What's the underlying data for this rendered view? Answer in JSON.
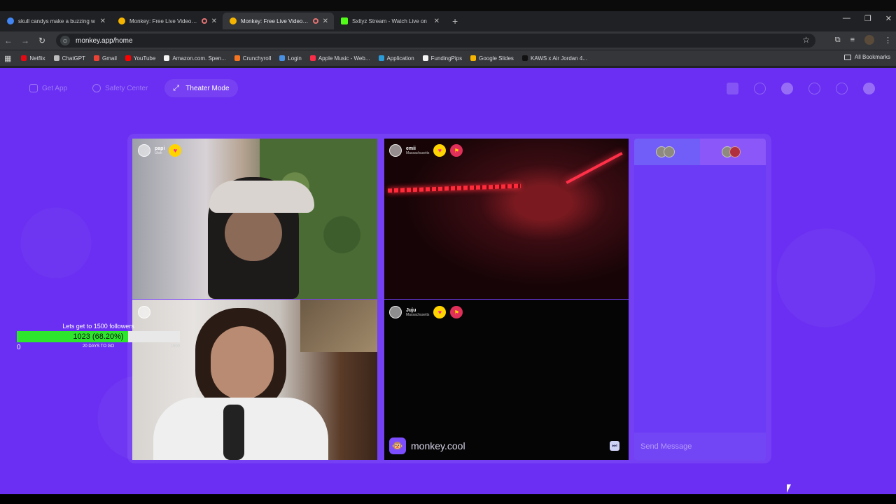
{
  "browser": {
    "tabs": [
      {
        "title": "skull candys make a buzzing w",
        "favicon_color": "#4285f4",
        "recording": false,
        "active": false
      },
      {
        "title": "Monkey: Free Live Video Ch",
        "favicon_color": "#f4b400",
        "recording": true,
        "active": false
      },
      {
        "title": "Monkey: Free Live Video Ch",
        "favicon_color": "#f4b400",
        "recording": true,
        "active": true
      },
      {
        "title": "Sxltyz Stream - Watch Live on",
        "favicon_color": "#53fc18",
        "recording": false,
        "active": false
      }
    ],
    "new_tab_glyph": "+",
    "url": "monkey.app/home",
    "bookmarks": [
      {
        "label": "Netflix",
        "color": "#e50914"
      },
      {
        "label": "ChatGPT",
        "color": "#bdbdbd"
      },
      {
        "label": "Gmail",
        "color": "#ea4335"
      },
      {
        "label": "YouTube",
        "color": "#ff0000"
      },
      {
        "label": "Amazon.com. Spen...",
        "color": "#f5f5f5"
      },
      {
        "label": "Crunchyroll",
        "color": "#f47521"
      },
      {
        "label": "Login",
        "color": "#4a90e2"
      },
      {
        "label": "Apple Music - Web...",
        "color": "#fa2d48"
      },
      {
        "label": "Application",
        "color": "#2b9cd8"
      },
      {
        "label": "FundingPips",
        "color": "#f5f5f5"
      },
      {
        "label": "Google Slides",
        "color": "#f4b400"
      },
      {
        "label": "KAWS x Air Jordan 4...",
        "color": "#111111"
      }
    ],
    "all_bookmarks": "All Bookmarks"
  },
  "app": {
    "nav": {
      "get_app": "Get App",
      "safety_center": "Safety Center",
      "theater_mode": "Theater Mode"
    },
    "tiles": [
      {
        "name": "papi",
        "location": "Utah"
      },
      {
        "name": "emii",
        "location": "Massachusetts"
      },
      {
        "name": "",
        "location": ""
      },
      {
        "name": "Juju",
        "location": "Massachusetts"
      }
    ],
    "brand": "monkey.cool",
    "chat_placeholder": "Send Message"
  },
  "goal": {
    "title": "Lets get to 1500 followers",
    "current_label": "1023 (68.20%)",
    "progress_fraction": 0.682,
    "min": "0",
    "days_left": "20 DAYS TO GO",
    "max": "1500"
  },
  "colors": {
    "page_bg": "#6a2ff2",
    "accent": "#ffd400",
    "goal_fill": "#2ee52e"
  }
}
